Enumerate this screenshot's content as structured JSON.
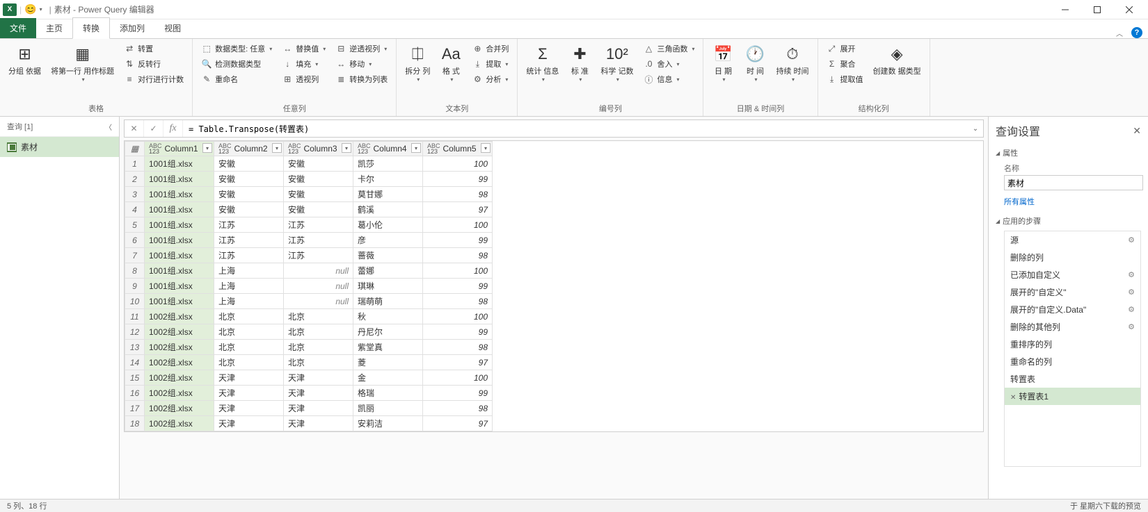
{
  "title": "素材 - Power Query 编辑器",
  "tabs": {
    "file": "文件",
    "home": "主页",
    "transform": "转换",
    "addcol": "添加列",
    "view": "视图"
  },
  "ribbon": {
    "g1": {
      "groupby": "分组\n依据",
      "firstrow": "将第一行\n用作标题",
      "transpose": "转置",
      "reverse": "反转行",
      "count": "对行进行计数",
      "label": "表格"
    },
    "g2": {
      "datatype": "数据类型: 任意",
      "detect": "检测数据类型",
      "rename": "重命名",
      "replace": "替换值",
      "fill": "填充",
      "pivot": "透视列",
      "unpivot": "逆透视列",
      "move": "移动",
      "tolist": "转换为列表",
      "label": "任意列"
    },
    "g3": {
      "split": "拆分\n列",
      "format": "格\n式",
      "merge": "合并列",
      "extract": "提取",
      "parse": "分析",
      "label": "文本列"
    },
    "g4": {
      "stats": "统计\n信息",
      "standard": "标\n准",
      "sci": "科学\n记数",
      "trig": "三角函数",
      "round": "舍入",
      "info": "信息",
      "label": "编号列"
    },
    "g5": {
      "date": "日\n期",
      "time": "时\n间",
      "duration": "持续\n时间",
      "label": "日期 & 时间列"
    },
    "g6": {
      "expand": "展开",
      "aggregate": "聚合",
      "extractval": "提取值",
      "create": "创建数\n据类型",
      "label": "结构化列"
    }
  },
  "queries": {
    "header": "查询 [1]",
    "item": "素材"
  },
  "formula": "= Table.Transpose(转置表)",
  "columns": [
    "Column1",
    "Column2",
    "Column3",
    "Column4",
    "Column5"
  ],
  "rows": [
    [
      "1001组.xlsx",
      "安徽",
      "安徽",
      "凯莎",
      "100"
    ],
    [
      "1001组.xlsx",
      "安徽",
      "安徽",
      "卡尔",
      "99"
    ],
    [
      "1001组.xlsx",
      "安徽",
      "安徽",
      "莫甘娜",
      "98"
    ],
    [
      "1001组.xlsx",
      "安徽",
      "安徽",
      "鹤溪",
      "97"
    ],
    [
      "1001组.xlsx",
      "江苏",
      "江苏",
      "葛小伦",
      "100"
    ],
    [
      "1001组.xlsx",
      "江苏",
      "江苏",
      "彦",
      "99"
    ],
    [
      "1001组.xlsx",
      "江苏",
      "江苏",
      "蔷薇",
      "98"
    ],
    [
      "1001组.xlsx",
      "上海",
      null,
      "蕾娜",
      "100"
    ],
    [
      "1001组.xlsx",
      "上海",
      null,
      "琪琳",
      "99"
    ],
    [
      "1001组.xlsx",
      "上海",
      null,
      "瑞萌萌",
      "98"
    ],
    [
      "1002组.xlsx",
      "北京",
      "北京",
      "秋",
      "100"
    ],
    [
      "1002组.xlsx",
      "北京",
      "北京",
      "丹尼尔",
      "99"
    ],
    [
      "1002组.xlsx",
      "北京",
      "北京",
      "紫堂真",
      "98"
    ],
    [
      "1002组.xlsx",
      "北京",
      "北京",
      "菱",
      "97"
    ],
    [
      "1002组.xlsx",
      "天津",
      "天津",
      "金",
      "100"
    ],
    [
      "1002组.xlsx",
      "天津",
      "天津",
      "格瑞",
      "99"
    ],
    [
      "1002组.xlsx",
      "天津",
      "天津",
      "凯丽",
      "98"
    ],
    [
      "1002组.xlsx",
      "天津",
      "天津",
      "安莉洁",
      "97"
    ]
  ],
  "settings": {
    "title": "查询设置",
    "props": "属性",
    "name_label": "名称",
    "name_value": "素材",
    "all_props": "所有属性",
    "steps_label": "应用的步骤",
    "steps": [
      {
        "name": "源",
        "gear": true
      },
      {
        "name": "删除的列",
        "gear": false
      },
      {
        "name": "已添加自定义",
        "gear": true
      },
      {
        "name": "展开的\"自定义\"",
        "gear": true
      },
      {
        "name": "展开的\"自定义.Data\"",
        "gear": true
      },
      {
        "name": "删除的其他列",
        "gear": true
      },
      {
        "name": "重排序的列",
        "gear": false
      },
      {
        "name": "重命名的列",
        "gear": false
      },
      {
        "name": "转置表",
        "gear": false
      },
      {
        "name": "转置表1",
        "gear": false,
        "active": true
      }
    ]
  },
  "status": {
    "left": "5 列、18 行",
    "right": "于 星期六下载的预览"
  }
}
